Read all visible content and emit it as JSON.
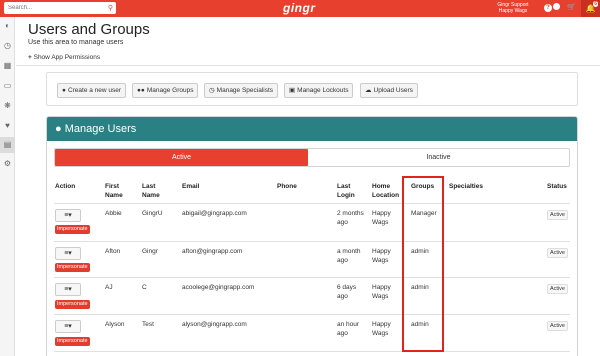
{
  "topbar": {
    "search_placeholder": "Search...",
    "logo": "gingr",
    "account_line1": "Gingr Support",
    "account_line2": "Happy Wags",
    "help_icon": "?",
    "notification_count": "6"
  },
  "sidebar": {
    "icons": [
      "dashboard-icon",
      "clock-icon",
      "calendar-icon",
      "card-icon",
      "paw-icon",
      "heart-icon",
      "book-icon",
      "gears-icon"
    ]
  },
  "header": {
    "title": "Users and Groups",
    "subtitle": "Use this area to manage users",
    "show_permissions": "Show App Permissions"
  },
  "actions": {
    "create_user": "Create a new user",
    "manage_groups": "Manage Groups",
    "manage_specialists": "Manage Specialists",
    "manage_lockouts": "Manage Lockouts",
    "upload_users": "Upload Users"
  },
  "manage_users": {
    "title": "Manage Users",
    "tab_active": "Active",
    "tab_inactive": "Inactive",
    "columns": {
      "action": "Action",
      "first_name": "First Name",
      "last_name": "Last Name",
      "email": "Email",
      "phone": "Phone",
      "last_login": "Last Login",
      "home_location": "Home Location",
      "groups": "Groups",
      "specialties": "Specialties",
      "status": "Status"
    },
    "impersonate_label": "Impersonate",
    "rows": [
      {
        "first": "Abbie",
        "last": "GingrU",
        "email": "abigail@gingrapp.com",
        "phone": "",
        "last_login": "2 months ago",
        "location": "Happy Wags",
        "group": "Manager",
        "specialties": "",
        "status": "Active"
      },
      {
        "first": "Afton",
        "last": "Gingr",
        "email": "afton@gingrapp.com",
        "phone": "",
        "last_login": "a month ago",
        "location": "Happy Wags",
        "group": "admin",
        "specialties": "",
        "status": "Active"
      },
      {
        "first": "AJ",
        "last": "C",
        "email": "acoolege@gingrapp.com",
        "phone": "",
        "last_login": "6 days ago",
        "location": "Happy Wags",
        "group": "admin",
        "specialties": "",
        "status": "Active"
      },
      {
        "first": "Alyson",
        "last": "Test",
        "email": "alyson@gingrapp.com",
        "phone": "",
        "last_login": "an hour ago",
        "location": "Happy Wags",
        "group": "admin",
        "specialties": "",
        "status": "Active"
      }
    ]
  },
  "colors": {
    "brand_red": "#e8402f",
    "panel_teal": "#2a8183",
    "highlight_red": "#e0241b"
  }
}
